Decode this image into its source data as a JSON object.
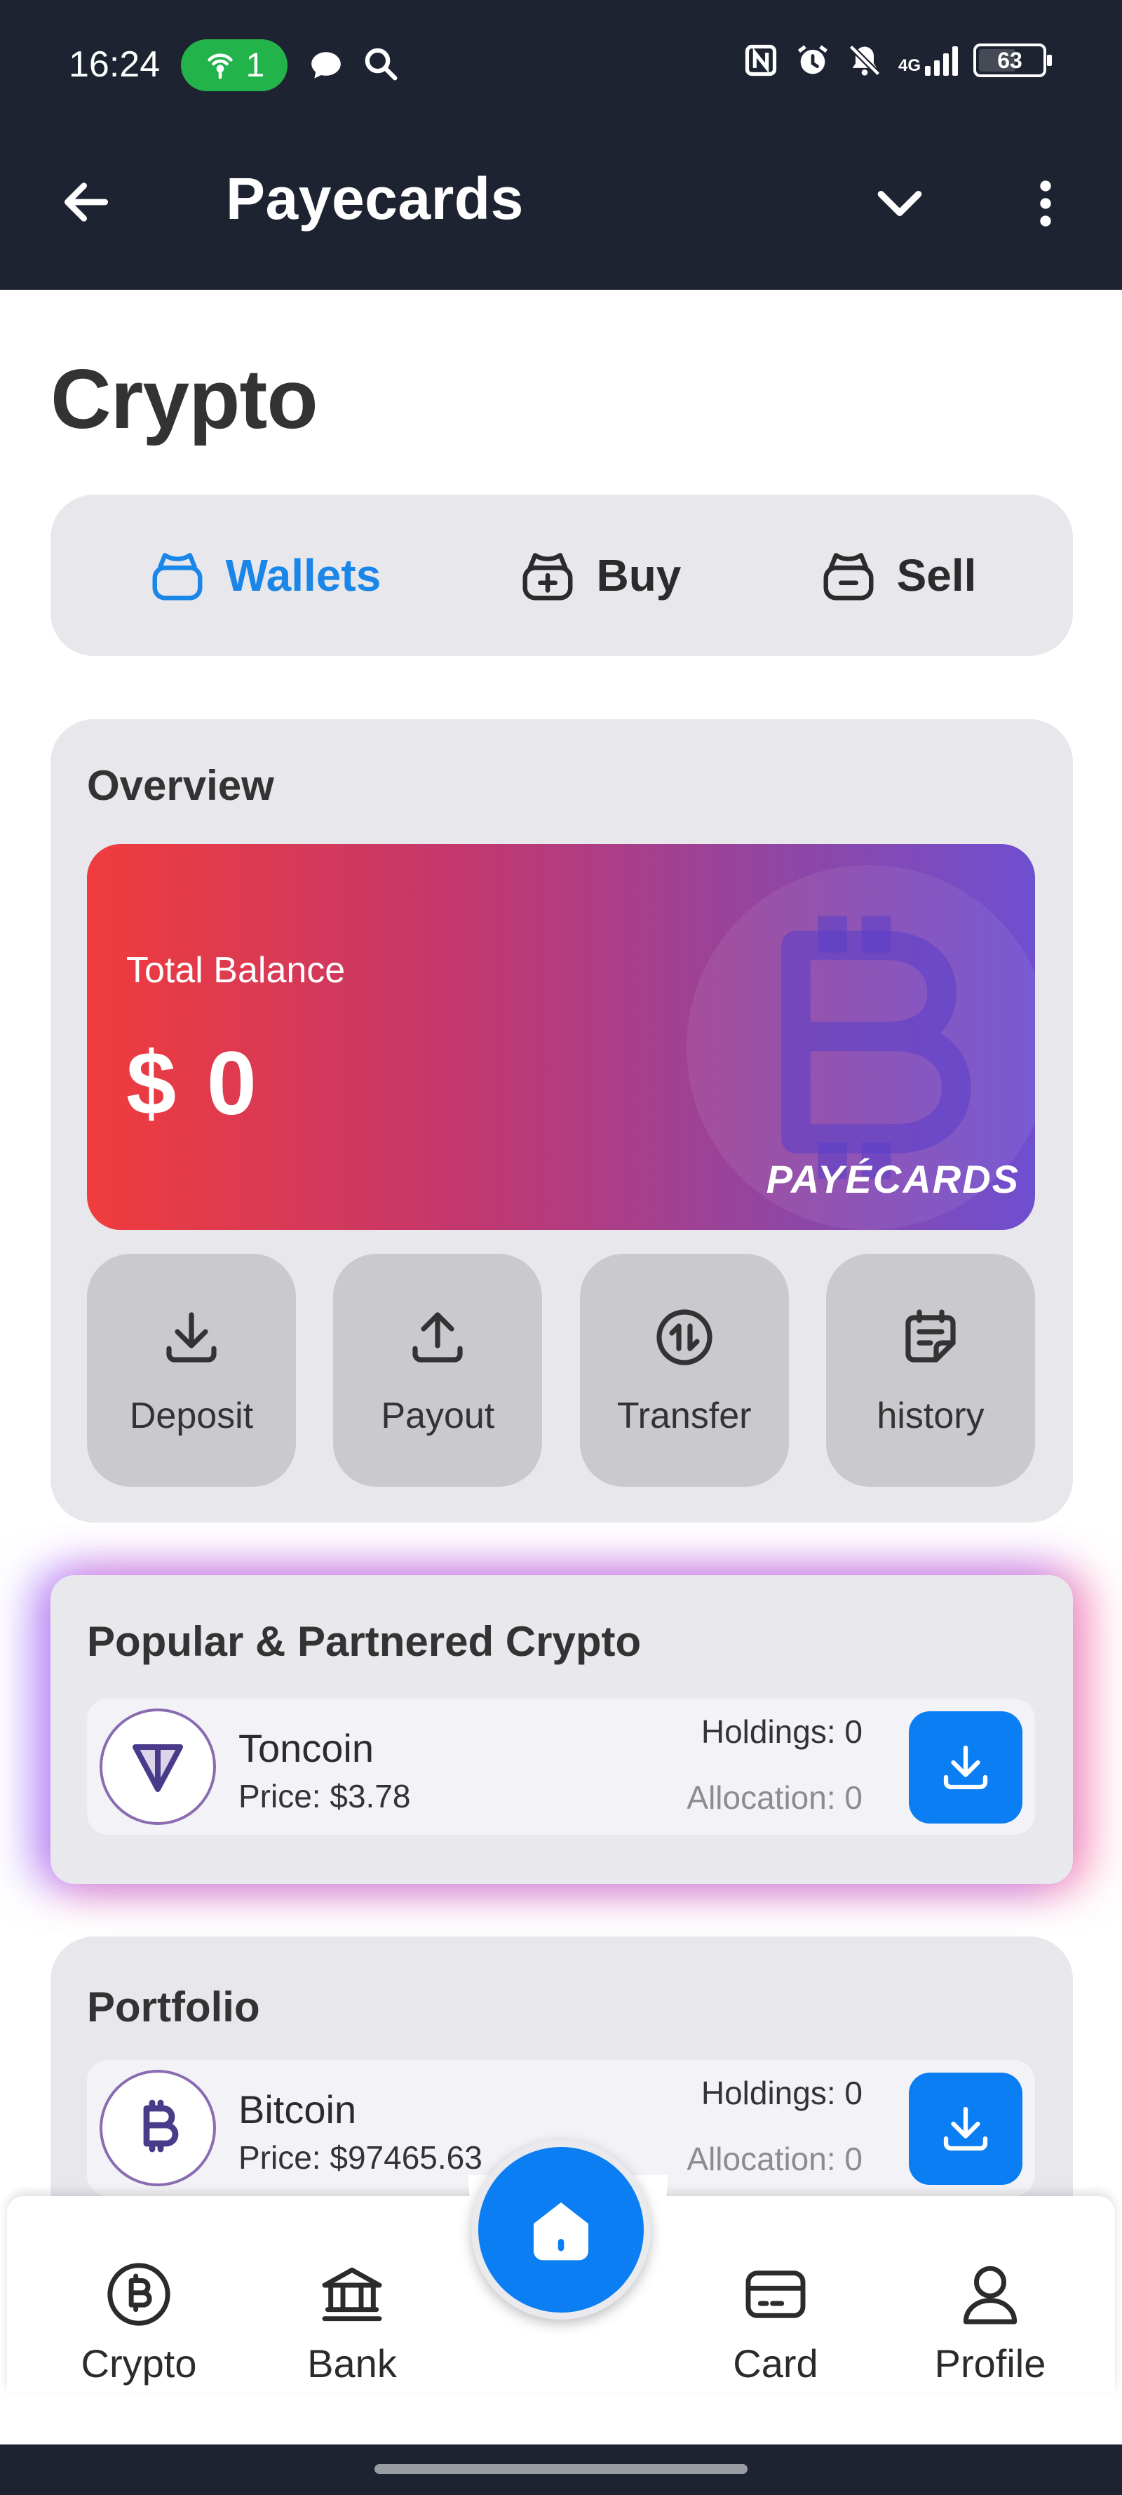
{
  "status_bar": {
    "time": "16:24",
    "hotspot_count": "1",
    "battery_level": "63",
    "network": "4G",
    "icons": [
      "hotspot-icon",
      "chat-icon",
      "search-icon",
      "nfc-icon",
      "alarm-icon",
      "mute-icon",
      "signal-icon",
      "battery-icon"
    ]
  },
  "app_bar": {
    "title": "Payecards",
    "icons": [
      "back-arrow-icon",
      "chevron-down-icon",
      "more-vertical-icon"
    ]
  },
  "page": {
    "title": "Crypto"
  },
  "tabs": [
    {
      "label": "Wallets",
      "icon": "wallet-icon",
      "active": true
    },
    {
      "label": "Buy",
      "icon": "wallet-plus-icon",
      "active": false
    },
    {
      "label": "Sell",
      "icon": "wallet-minus-icon",
      "active": false
    }
  ],
  "overview": {
    "title": "Overview",
    "balance_label": "Total Balance",
    "balance_value": "$ 0",
    "brand": "PAYÉCARDS",
    "actions": [
      {
        "label": "Deposit",
        "icon": "download-icon"
      },
      {
        "label": "Payout",
        "icon": "upload-icon"
      },
      {
        "label": "Transfer",
        "icon": "transfer-icon"
      },
      {
        "label": "history",
        "icon": "history-icon"
      }
    ]
  },
  "popular": {
    "title": "Popular & Partnered Crypto",
    "items": [
      {
        "name": "Toncoin",
        "price": "Price: $3.78",
        "holdings": "Holdings: 0",
        "allocation": "Allocation: 0",
        "icon": "toncoin-icon"
      }
    ]
  },
  "portfolio": {
    "title": "Portfolio",
    "items": [
      {
        "name": "Bitcoin",
        "price": "Price: $97465.63",
        "holdings": "Holdings: 0",
        "allocation": "Allocation: 0",
        "icon": "bitcoin-icon"
      }
    ]
  },
  "bottom_nav": [
    {
      "label": "Crypto",
      "icon": "bitcoin-circle-icon"
    },
    {
      "label": "Bank",
      "icon": "bank-icon"
    },
    {
      "label": "Card",
      "icon": "card-icon"
    },
    {
      "label": "Profile",
      "icon": "profile-icon"
    }
  ],
  "home_button": {
    "icon": "home-icon"
  },
  "colors": {
    "header_bg": "#1d2330",
    "accent_blue": "#0a7ef2",
    "active_tab": "#1a86e8",
    "card_bg": "#e7e7ec",
    "action_bg": "#c9c9ce",
    "gradient_start": "#f03c3c",
    "gradient_end": "#6f4fd0"
  }
}
